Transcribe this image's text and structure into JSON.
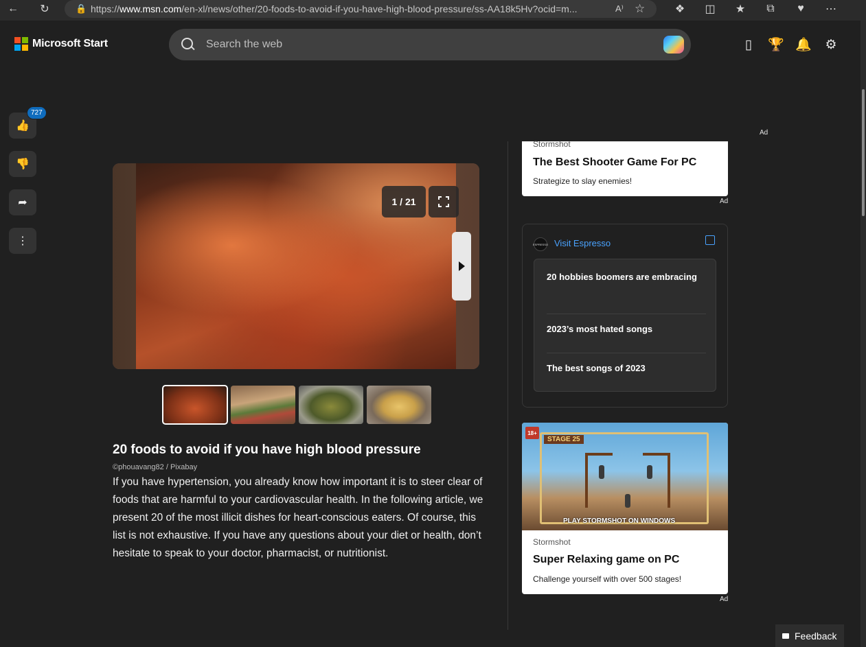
{
  "browser": {
    "url_prefix": "https://",
    "url_host": "www.msn.com",
    "url_path": "/en-xl/news/other/20-foods-to-avoid-if-you-have-high-blood-pressure/ss-AA18k5Hv?ocid=m...",
    "read_aloud": "A⁾"
  },
  "header": {
    "brand": "Microsoft Start",
    "search_placeholder": "Search the web"
  },
  "rail": {
    "like_count": "727"
  },
  "slideshow": {
    "counter": "1 / 21",
    "thumbnail_count": 4
  },
  "article": {
    "title": "20 foods to avoid if you have high blood pressure",
    "credit": "©phouavang82 / Pixabay",
    "body": "If you have hypertension, you already know how important it is to steer clear of foods that are harmful to your cardiovascular health. In the following article, we present 20 of the most illicit dishes for heart-conscious eaters. Of course, this list is not exhaustive. If you have any questions about your diet or health, don’t hesitate to speak to your doctor, pharmacist, or nutritionist."
  },
  "ads": {
    "ad_label": "Ad",
    "card1": {
      "brand": "Stormshot",
      "title": "The Best Shooter Game For PC",
      "description": "Strategize to slay enemies!"
    },
    "espresso": {
      "logo_text": "ESPRESSO",
      "link": "Visit Espresso",
      "items": [
        "20 hobbies boomers are embracing",
        "2023’s most hated songs",
        "The best songs of 2023"
      ]
    },
    "card2": {
      "age_badge": "18+",
      "stage_label": "STAGE 25",
      "play_label": "PLAY STORMSHOT ON WINDOWS",
      "brand": "Stormshot",
      "title": "Super Relaxing game on PC",
      "description": "Challenge yourself with over 500 stages!"
    }
  },
  "feedback": {
    "label": "Feedback"
  },
  "colors": {
    "page_bg": "#202020",
    "accent_blue": "#0f6cbd",
    "link_blue": "#4aa3ff",
    "ms_red": "#f25022",
    "ms_green": "#7fba00",
    "ms_blue": "#00a4ef",
    "ms_yellow": "#ffb900"
  }
}
